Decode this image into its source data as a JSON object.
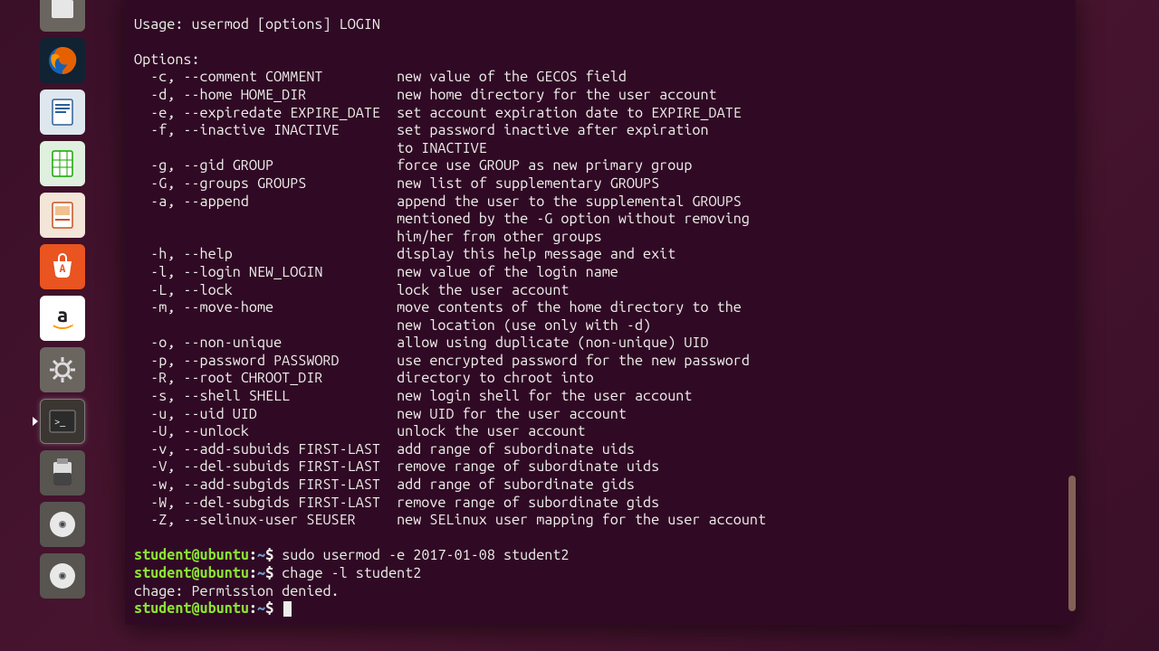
{
  "launcher": {
    "items": [
      {
        "id": "files",
        "active": false
      },
      {
        "id": "firefox",
        "active": false
      },
      {
        "id": "writer",
        "active": false
      },
      {
        "id": "calc",
        "active": false
      },
      {
        "id": "impress",
        "active": false
      },
      {
        "id": "software",
        "active": false
      },
      {
        "id": "amazon",
        "active": false
      },
      {
        "id": "settings",
        "active": false
      },
      {
        "id": "terminal",
        "active": true
      },
      {
        "id": "usb",
        "active": false
      },
      {
        "id": "disc1",
        "active": false
      },
      {
        "id": "disc2",
        "active": false
      }
    ]
  },
  "terminal": {
    "usage": "Usage: usermod [options] LOGIN",
    "options_header": "Options:",
    "options": [
      {
        "flag": "  -c, --comment COMMENT         ",
        "desc": "new value of the GECOS field"
      },
      {
        "flag": "  -d, --home HOME_DIR           ",
        "desc": "new home directory for the user account"
      },
      {
        "flag": "  -e, --expiredate EXPIRE_DATE  ",
        "desc": "set account expiration date to EXPIRE_DATE"
      },
      {
        "flag": "  -f, --inactive INACTIVE       ",
        "desc": "set password inactive after expiration"
      },
      {
        "flag": "                                ",
        "desc": "to INACTIVE"
      },
      {
        "flag": "  -g, --gid GROUP               ",
        "desc": "force use GROUP as new primary group"
      },
      {
        "flag": "  -G, --groups GROUPS           ",
        "desc": "new list of supplementary GROUPS"
      },
      {
        "flag": "  -a, --append                  ",
        "desc": "append the user to the supplemental GROUPS"
      },
      {
        "flag": "                                ",
        "desc": "mentioned by the -G option without removing"
      },
      {
        "flag": "                                ",
        "desc": "him/her from other groups"
      },
      {
        "flag": "  -h, --help                    ",
        "desc": "display this help message and exit"
      },
      {
        "flag": "  -l, --login NEW_LOGIN         ",
        "desc": "new value of the login name"
      },
      {
        "flag": "  -L, --lock                    ",
        "desc": "lock the user account"
      },
      {
        "flag": "  -m, --move-home               ",
        "desc": "move contents of the home directory to the"
      },
      {
        "flag": "                                ",
        "desc": "new location (use only with -d)"
      },
      {
        "flag": "  -o, --non-unique              ",
        "desc": "allow using duplicate (non-unique) UID"
      },
      {
        "flag": "  -p, --password PASSWORD       ",
        "desc": "use encrypted password for the new password"
      },
      {
        "flag": "  -R, --root CHROOT_DIR         ",
        "desc": "directory to chroot into"
      },
      {
        "flag": "  -s, --shell SHELL             ",
        "desc": "new login shell for the user account"
      },
      {
        "flag": "  -u, --uid UID                 ",
        "desc": "new UID for the user account"
      },
      {
        "flag": "  -U, --unlock                  ",
        "desc": "unlock the user account"
      },
      {
        "flag": "  -v, --add-subuids FIRST-LAST  ",
        "desc": "add range of subordinate uids"
      },
      {
        "flag": "  -V, --del-subuids FIRST-LAST  ",
        "desc": "remove range of subordinate uids"
      },
      {
        "flag": "  -w, --add-subgids FIRST-LAST  ",
        "desc": "add range of subordinate gids"
      },
      {
        "flag": "  -W, --del-subgids FIRST-LAST  ",
        "desc": "remove range of subordinate gids"
      },
      {
        "flag": "  -Z, --selinux-user SEUSER     ",
        "desc": "new SELinux user mapping for the user account"
      }
    ],
    "prompt": {
      "user": "student@ubuntu",
      "sep": ":",
      "path": "~",
      "end": "$ "
    },
    "history": [
      {
        "cmd": "sudo usermod -e 2017-01-08 student2"
      },
      {
        "cmd": "chage -l student2"
      }
    ],
    "output_after": "chage: Permission denied.",
    "current_cmd": ""
  }
}
